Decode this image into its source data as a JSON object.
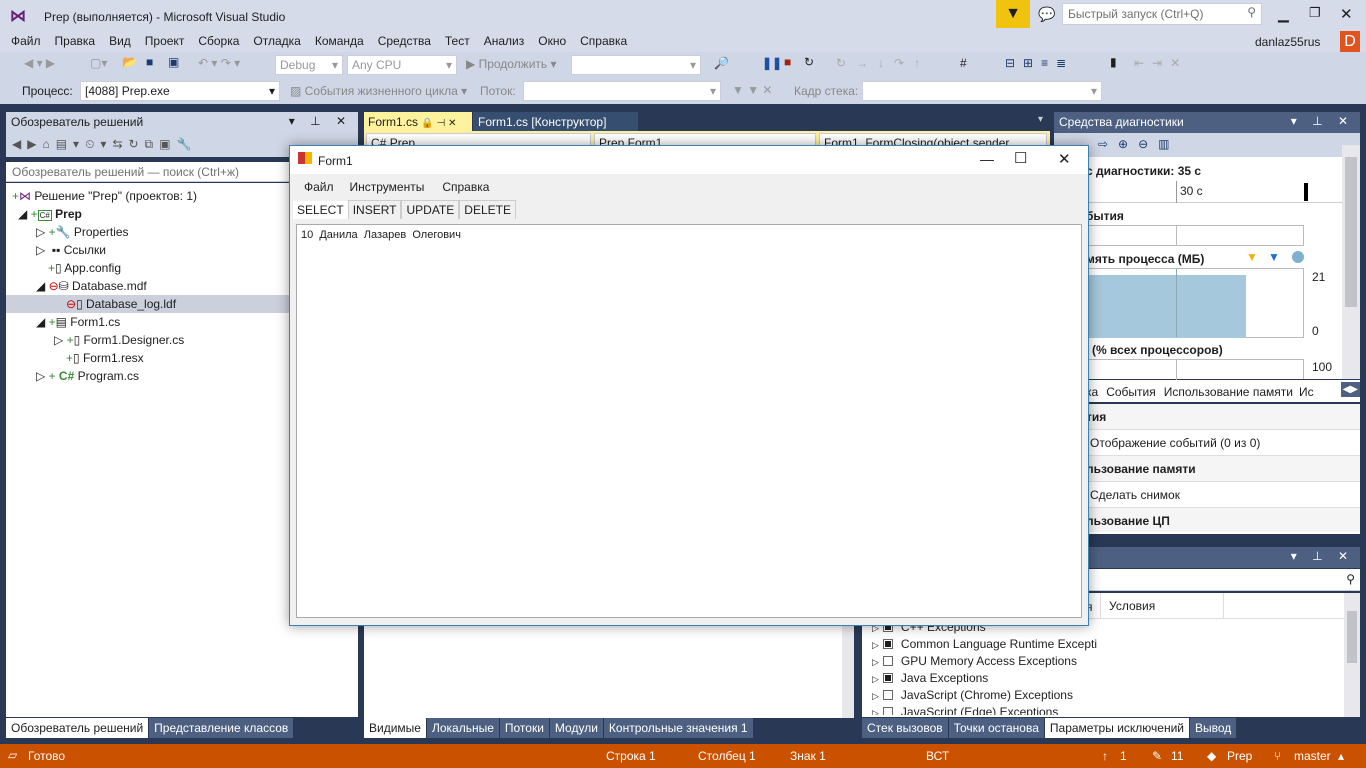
{
  "window": {
    "title": "Prep (выполняется) - Microsoft Visual Studio",
    "quick_launch_placeholder": "Быстрый запуск (Ctrl+Q)",
    "user": "danlaz55rus",
    "avatar_letter": "D"
  },
  "menu": [
    "Файл",
    "Правка",
    "Вид",
    "Проект",
    "Сборка",
    "Отладка",
    "Команда",
    "Средства",
    "Тест",
    "Анализ",
    "Окно",
    "Справка"
  ],
  "toolbar": {
    "config": "Debug",
    "platform": "Any CPU",
    "continue": "Продолжить",
    "process_label": "Процесс:",
    "process": "[4088] Prep.exe",
    "lifecycle": "События жизненного цикла",
    "thread_label": "Поток:",
    "stack_label": "Кадр стека:"
  },
  "solution_explorer": {
    "title": "Обозреватель решений",
    "search_placeholder": "Обозреватель решений — поиск (Ctrl+ж)",
    "items": [
      "Решение \"Prep\"  (проектов: 1)",
      "Prep",
      "Properties",
      "Ссылки",
      "App.config",
      "Database.mdf",
      "Database_log.ldf",
      "Form1.cs",
      "Form1.Designer.cs",
      "Form1.resx",
      "Program.cs"
    ],
    "tabs": [
      "Обозреватель решений",
      "Представление классов"
    ]
  },
  "editor": {
    "tabs": [
      "Form1.cs",
      "Form1.cs [Конструктор]"
    ],
    "nav": [
      "Prep",
      "Prep.Form1",
      "Form1_FormClosing(object sender"
    ]
  },
  "form1": {
    "title": "Form1",
    "menu": [
      "Файл",
      "Инструменты",
      "Справка"
    ],
    "tabs": [
      "SELECT",
      "INSERT",
      "UPDATE",
      "DELETE"
    ],
    "content": "10  Данила  Лазарев  Олегович"
  },
  "diagnostics": {
    "title": "Средства диагностики",
    "session": "с диагностики: 35 с",
    "timeline_tick": "30 с",
    "events": "бытия",
    "memory": "мять процесса (МБ)",
    "mem_max": "21",
    "mem_min": "0",
    "cpu": "(% всех процессоров)",
    "cpu_max": "100",
    "tabs": [
      "ка",
      "События",
      "Использование памяти",
      "Ис"
    ],
    "sections": [
      "тия",
      "Отображение событий (0 из 0)",
      "льзование памяти",
      "Сделать снимок",
      "льзование ЦП"
    ]
  },
  "exceptions": {
    "columns": [
      "я",
      "Условия"
    ],
    "items": [
      {
        "name": "C++ Exceptions",
        "checked": true
      },
      {
        "name": "Common Language Runtime Excepti",
        "checked": true
      },
      {
        "name": "GPU Memory Access Exceptions",
        "checked": false
      },
      {
        "name": "Java Exceptions",
        "checked": true
      },
      {
        "name": "JavaScript (Chrome) Exceptions",
        "checked": false
      },
      {
        "name": "JavaScript (Edge) Exceptions",
        "checked": false
      }
    ]
  },
  "bottom_tabs_middle": [
    "Видимые",
    "Локальные",
    "Потоки",
    "Модули",
    "Контрольные значения 1"
  ],
  "bottom_tabs_right": [
    "Стек вызовов",
    "Точки останова",
    "Параметры исключений",
    "Вывод"
  ],
  "status": {
    "ready": "Готово",
    "line": "Строка 1",
    "col": "Столбец 1",
    "char": "Знак 1",
    "mode": "ВСТ",
    "push": "1",
    "edits": "11",
    "repo": "Prep",
    "branch": "master"
  }
}
